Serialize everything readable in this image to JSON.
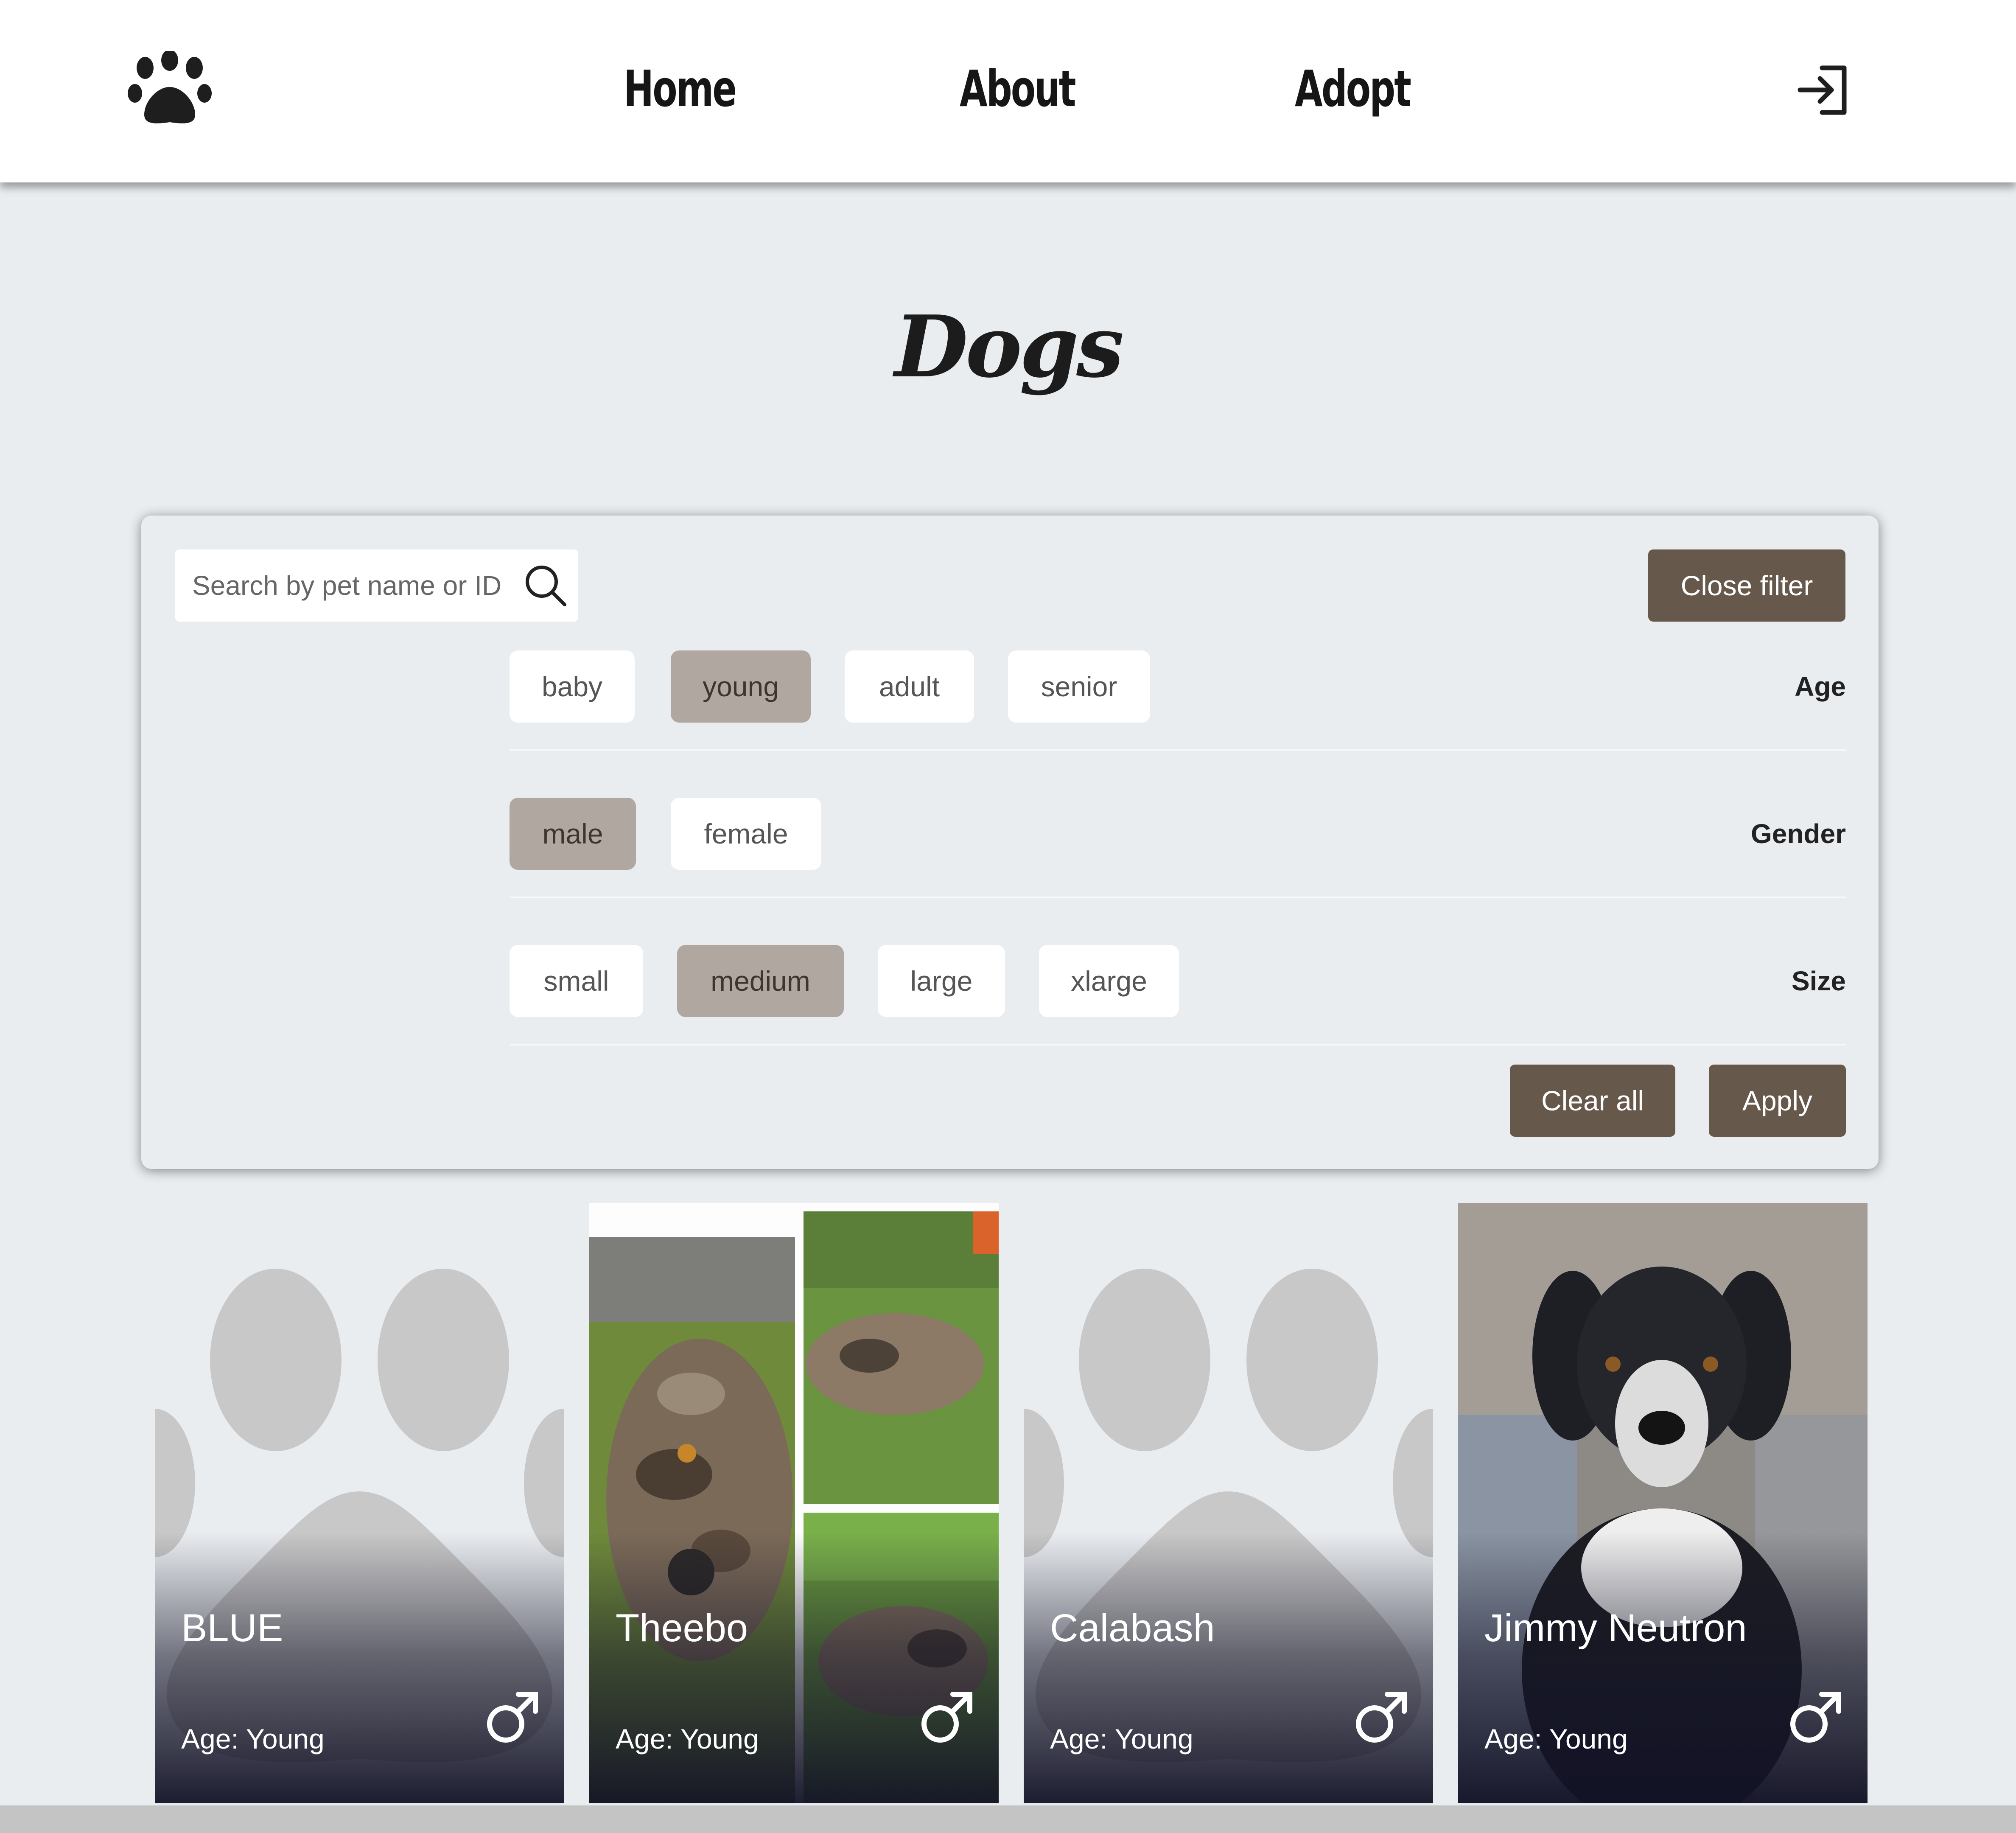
{
  "nav": {
    "home": "Home",
    "about": "About",
    "adopt": "Adopt"
  },
  "page": {
    "title": "Dogs"
  },
  "filter": {
    "search_placeholder": "Search by pet name or ID",
    "close_label": "Close filter",
    "age": {
      "label": "Age",
      "options": [
        "baby",
        "young",
        "adult",
        "senior"
      ],
      "selected": "young"
    },
    "gender": {
      "label": "Gender",
      "options": [
        "male",
        "female"
      ],
      "selected": "male"
    },
    "size": {
      "label": "Size",
      "options": [
        "small",
        "medium",
        "large",
        "xlarge"
      ],
      "selected": "medium"
    },
    "clear_label": "Clear all",
    "apply_label": "Apply"
  },
  "pets": [
    {
      "name": "BLUE",
      "age": "Age: Young",
      "gender_icon": "male-icon",
      "image": "paw-placeholder"
    },
    {
      "name": "Theebo",
      "age": "Age: Young",
      "gender_icon": "male-icon",
      "image": "photo-collage-dog"
    },
    {
      "name": "Calabash",
      "age": "Age: Young",
      "gender_icon": "male-icon",
      "image": "paw-placeholder"
    },
    {
      "name": "Jimmy Neutron",
      "age": "Age: Young",
      "gender_icon": "male-icon",
      "image": "photo-dog"
    }
  ],
  "colors": {
    "accent": "#66584b",
    "chip_selected": "#b0a7a1",
    "background": "#eaedf0"
  }
}
